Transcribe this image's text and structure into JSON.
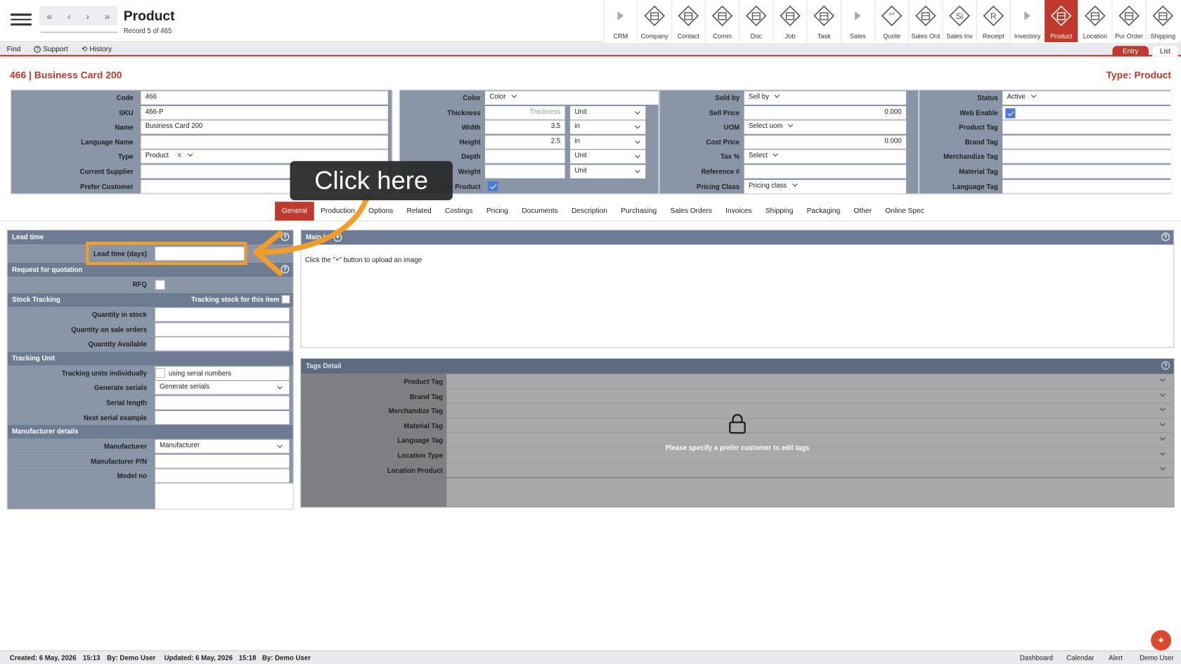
{
  "header": {
    "title": "Product",
    "record_info": "Record 5 of 465"
  },
  "nav_buttons": [
    {
      "label": "CRM",
      "icon": "arrow-icon"
    },
    {
      "label": "Company",
      "icon": "company-icon"
    },
    {
      "label": "Contact",
      "icon": "contact-icon"
    },
    {
      "label": "Comm",
      "icon": "comm-icon"
    },
    {
      "label": "Doc",
      "icon": "doc-icon"
    },
    {
      "label": "Job",
      "icon": "job-icon"
    },
    {
      "label": "Task",
      "icon": "task-icon"
    },
    {
      "label": "Sales",
      "icon": "arrow-icon"
    },
    {
      "label": "Quote",
      "icon": "quote-icon"
    },
    {
      "label": "Sales Ord",
      "icon": "sales-ord-icon"
    },
    {
      "label": "Sales Inv",
      "icon": "sales-inv-icon"
    },
    {
      "label": "Receipt",
      "icon": "receipt-icon"
    },
    {
      "label": "Inventory",
      "icon": "arrow-icon"
    },
    {
      "label": "Product",
      "icon": "product-icon"
    },
    {
      "label": "Location",
      "icon": "location-icon"
    },
    {
      "label": "Pur Order",
      "icon": "pur-order-icon"
    },
    {
      "label": "Shipping",
      "icon": "shipping-icon"
    }
  ],
  "nav_glyphs": {
    "Quote": "“”",
    "Sales Inv": "Si",
    "Receipt": "R"
  },
  "toolbar": {
    "find": "Find",
    "support": "Support",
    "history": "History",
    "entry": "Entry",
    "list": "List"
  },
  "record": {
    "heading": "466 | Business Card 200",
    "type": "Type: Product"
  },
  "panel1": {
    "code_label": "Code",
    "code": "466",
    "sku_label": "SKU",
    "sku": "466-P",
    "name_label": "Name",
    "name": "Business Card 200",
    "language_name_label": "Language Name",
    "type_label": "Type",
    "type": "Product",
    "current_supplier_label": "Current Supplier",
    "prefer_customer_label": "Prefer Customer"
  },
  "panel2": {
    "color_label": "Color",
    "color": "Color",
    "thickness_label": "Thickness",
    "thickness_placeholder": "Thickness",
    "thickness_unit": "Unit",
    "width_label": "Width",
    "width": "3.5",
    "width_unit": "in",
    "height_label": "Height",
    "height": "2.5",
    "height_unit": "in",
    "depth_label": "Depth",
    "depth_unit": "Unit",
    "weight_label": "Weight",
    "weight_unit": "Unit",
    "master_product_label": "aster Product"
  },
  "panel3": {
    "sold_by_label": "Sold by",
    "sold_by": "Sell by",
    "sell_price_label": "Sell Price",
    "sell_price": "0.000",
    "uom_label": "UOM",
    "uom": "Select uom",
    "cost_price_label": "Cost Price",
    "cost_price": "0.000",
    "tax_label": "Tax %",
    "tax": "Select",
    "reference_label": "Reference #",
    "pricing_class_label": "Pricing Class",
    "pricing_class": "Pricing class"
  },
  "panel4": {
    "status_label": "Status",
    "status": "Active",
    "web_enable_label": "Web Enable",
    "product_tag_label": "Product Tag",
    "brand_tag_label": "Brand Tag",
    "merchandize_tag_label": "Merchandize Tag",
    "material_tag_label": "Material Tag",
    "language_tag_label": "Language Tag"
  },
  "subtabs": [
    "General",
    "Production",
    "Options",
    "Related",
    "Costings",
    "Pricing",
    "Documents",
    "Description",
    "Purchasing",
    "Sales Orders",
    "Invoices",
    "Shipping",
    "Packaging",
    "Other",
    "Online Spec"
  ],
  "lead": {
    "title": "Lead time",
    "lead_label": "Lead time (days)"
  },
  "rfq": {
    "title": "Request for quotation",
    "label": "RFQ"
  },
  "stock": {
    "title": "Stock Tracking",
    "tracking_label": "Tracking stock for this item",
    "qty_stock": "Quantity in stock",
    "qty_sale": "Quantity on sale orders",
    "qty_avail": "Quantity Available"
  },
  "tunit": {
    "title": "Tracking Unit",
    "individually": "Tracking units individually",
    "serial_text": "using serial numbers",
    "generate_label": "Generate serials",
    "generate": "Generate serials",
    "serial_length": "Serial length",
    "next_serial": "Next serial example"
  },
  "mfr": {
    "title": "Manufacturer details",
    "manufacturer_label": "Manufacturer",
    "manufacturer": "Manufacturer",
    "pn": "Manufacturer P/N",
    "model": "Model no"
  },
  "main_image": {
    "title": "Main In",
    "hint": "Click the \"+\" button to upload an image"
  },
  "tags": {
    "title": "Tags Detail",
    "rows": [
      "Product Tag",
      "Brand Tag",
      "Merchandize Tag",
      "Material Tag",
      "Language Tag",
      "Location Type",
      "Location Product"
    ],
    "locked_msg": "Please specify a prefer customer to edit tags"
  },
  "footer": {
    "created": "Created: 6 May, 2026",
    "created_time": "15:13",
    "created_by": "By: Demo User",
    "updated": "Updated: 6 May, 2026",
    "updated_time": "15:18",
    "updated_by": "By: Demo User",
    "links": [
      "Dashboard",
      "Calendar",
      "Alert",
      "Demo User"
    ]
  },
  "overlay": {
    "callout": "Click here"
  },
  "colors": {
    "accent": "#c0392b",
    "panel": "#8a95a8",
    "header": "#6d7c93",
    "highlight": "#f39c26"
  }
}
